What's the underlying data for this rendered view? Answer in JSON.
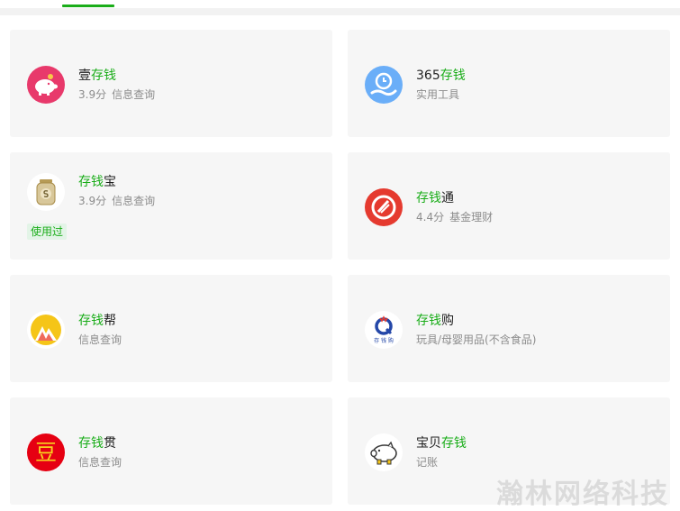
{
  "apps": [
    {
      "title_pre": "壹",
      "title_hl": "存钱",
      "title_post": "",
      "rating": "3.9分",
      "category": "信息查询",
      "icon": "piggy-bank-icon"
    },
    {
      "title_pre": "365",
      "title_hl": "存钱",
      "title_post": "",
      "rating": "",
      "category": "实用工具",
      "icon": "clock-hand-icon"
    },
    {
      "title_pre": "",
      "title_hl": "存钱",
      "title_post": "宝",
      "rating": "3.9分",
      "category": "信息查询",
      "badge": "使用过",
      "icon": "money-jar-icon"
    },
    {
      "title_pre": "",
      "title_hl": "存钱",
      "title_post": "通",
      "rating": "4.4分",
      "category": "基金理财",
      "icon": "red-circle-logo-icon"
    },
    {
      "title_pre": "",
      "title_hl": "存钱",
      "title_post": "帮",
      "rating": "",
      "category": "信息查询",
      "icon": "mountain-logo-icon"
    },
    {
      "title_pre": "",
      "title_hl": "存钱",
      "title_post": "购",
      "rating": "",
      "category": "玩具/母婴用品(不含食品)",
      "icon": "q-logo-icon"
    },
    {
      "title_pre": "",
      "title_hl": "存钱",
      "title_post": "贯",
      "rating": "",
      "category": "信息查询",
      "icon": "dou-character-icon"
    },
    {
      "title_pre": "宝贝",
      "title_hl": "存钱",
      "title_post": "",
      "rating": "",
      "category": "记账",
      "icon": "pig-icon"
    }
  ],
  "icon_texts": {
    "dou": "豆",
    "q_sub": "存 钱 购"
  },
  "watermark": "瀚林网络科技",
  "colors": {
    "accent": "#1aad19",
    "card_bg": "#f6f6f6",
    "badge_bg": "#e3f4e7"
  }
}
